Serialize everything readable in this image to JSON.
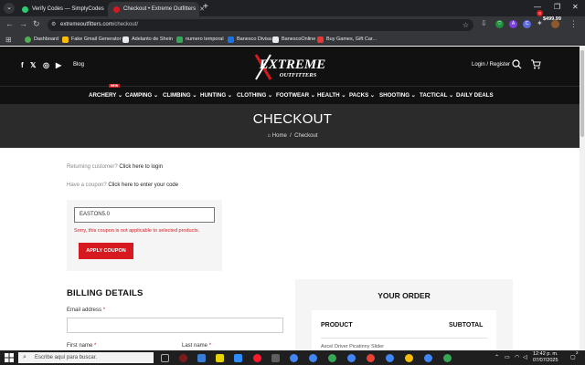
{
  "browser": {
    "tabs": [
      {
        "title": "Verify Codes — SimplyCodes",
        "active": false
      },
      {
        "title": "Checkout • Extreme Outfitters",
        "active": true
      }
    ],
    "url_host": "extremeoutfitters.com",
    "url_path": "/checkout/",
    "extensions": [
      "A",
      "C"
    ],
    "bookmarks": [
      {
        "label": "Dashboard"
      },
      {
        "label": "Fake Gmail Generator"
      },
      {
        "label": "Adelanto de Shein"
      },
      {
        "label": "numero temporal"
      },
      {
        "label": "Banesco Divisa"
      },
      {
        "label": "BanescoOnline"
      },
      {
        "label": "Buy Games, Gift Car..."
      }
    ]
  },
  "site": {
    "brand_top": "EXTREME",
    "brand_bottom": "OUTFITTERS",
    "blog": "Blog",
    "login": "Login / Register",
    "cart_count": "0",
    "cart_total": "$499.99",
    "new_badge": "NEW",
    "nav": [
      "ARCHERY",
      "CAMPING",
      "CLIMBING",
      "HUNTING",
      "CLOTHING",
      "FOOTWEAR",
      "HEALTH",
      "PACKS",
      "SHOOTING",
      "TACTICAL",
      "DAILY DEALS"
    ],
    "colors": {
      "accent": "#d71920",
      "header": "#111111",
      "hero": "#2b2b2b"
    }
  },
  "hero": {
    "title": "CHECKOUT",
    "crumb_home": "Home",
    "crumb_sep": "/",
    "crumb_current": "Checkout"
  },
  "checkout": {
    "returning_text": "Returning customer?",
    "returning_link": "Click here to login",
    "coupon_text": "Have a coupon?",
    "coupon_link": "Click here to enter your code",
    "coupon_value": "EASTON5.0",
    "coupon_error": "Sorry, this coupon is not applicable to selected products.",
    "apply_label": "APPLY COUPON",
    "billing_title": "BILLING DETAILS",
    "email_label": "Email address",
    "first_name_label": "First name",
    "last_name_label": "Last name",
    "required_mark": "*"
  },
  "order": {
    "title": "YOUR ORDER",
    "col_product": "PRODUCT",
    "col_subtotal": "SUBTOTAL",
    "first_item": "Axcel Driver Picatinny Slider"
  },
  "taskbar": {
    "search_placeholder": "Escribe aquí para buscar.",
    "time": "12:42 p. m.",
    "date": "07/07/2025",
    "notification_count": "2"
  }
}
